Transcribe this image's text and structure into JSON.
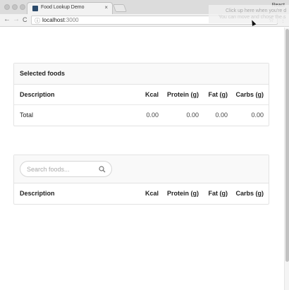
{
  "browser": {
    "tab_title": "Food Lookup Demo",
    "tab_close": "×",
    "profile_label": "React",
    "back": "←",
    "forward": "→",
    "reload": "C",
    "url_host": "localhost",
    "url_port": ":3000",
    "bookmark_star": "☆",
    "menu": "⋮",
    "hint_line1": "Click up here when you're d",
    "hint_line2": "You can move and chose the s"
  },
  "selected_foods": {
    "title": "Selected foods",
    "columns": [
      "Description",
      "Kcal",
      "Protein (g)",
      "Fat (g)",
      "Carbs (g)"
    ],
    "total": {
      "label": "Total",
      "kcal": "0.00",
      "protein": "0.00",
      "fat": "0.00",
      "carbs": "0.00"
    }
  },
  "search": {
    "placeholder": "Search foods...",
    "value": "",
    "columns": [
      "Description",
      "Kcal",
      "Protein (g)",
      "Fat (g)",
      "Carbs (g)"
    ]
  }
}
